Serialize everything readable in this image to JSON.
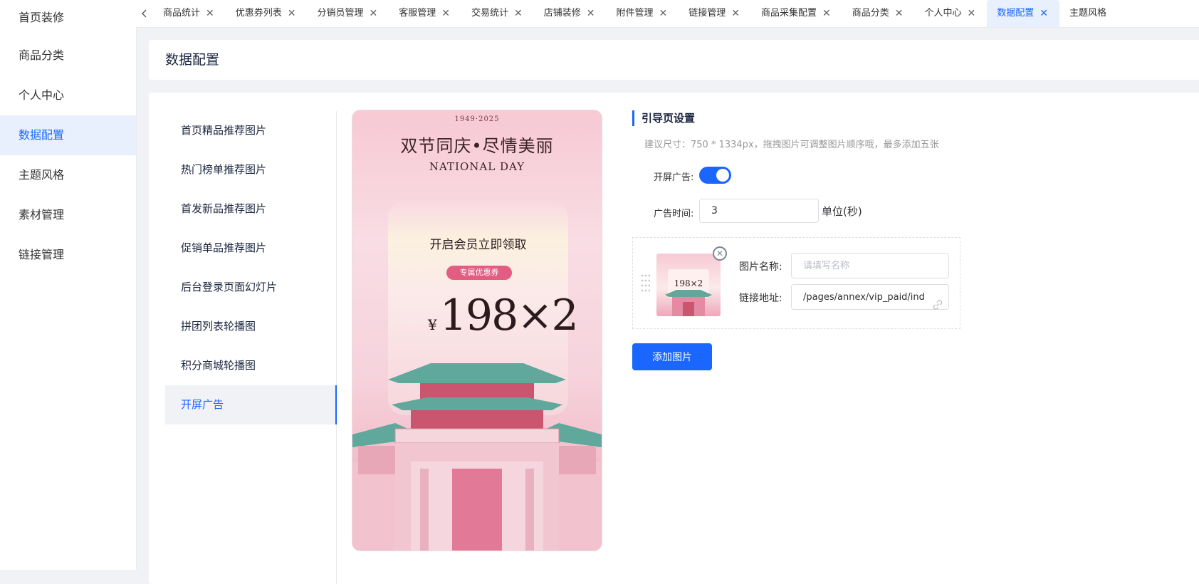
{
  "sidebar": {
    "items": [
      {
        "label": "首页装修"
      },
      {
        "label": "商品分类"
      },
      {
        "label": "个人中心"
      },
      {
        "label": "数据配置",
        "active": true
      },
      {
        "label": "主题风格"
      },
      {
        "label": "素材管理"
      },
      {
        "label": "链接管理"
      }
    ]
  },
  "tabs": [
    {
      "label": "商品统计"
    },
    {
      "label": "优惠券列表"
    },
    {
      "label": "分销员管理"
    },
    {
      "label": "客服管理"
    },
    {
      "label": "交易统计"
    },
    {
      "label": "店铺装修"
    },
    {
      "label": "附件管理"
    },
    {
      "label": "链接管理"
    },
    {
      "label": "商品采集配置"
    },
    {
      "label": "商品分类"
    },
    {
      "label": "个人中心"
    },
    {
      "label": "数据配置",
      "active": true
    },
    {
      "label": "主题风格"
    }
  ],
  "page": {
    "title": "数据配置"
  },
  "menu": {
    "items": [
      {
        "label": "首页精品推荐图片"
      },
      {
        "label": "热门榜单推荐图片"
      },
      {
        "label": "首发新品推荐图片"
      },
      {
        "label": "促销单品推荐图片"
      },
      {
        "label": "后台登录页面幻灯片"
      },
      {
        "label": "拼团列表轮播图"
      },
      {
        "label": "积分商城轮播图"
      },
      {
        "label": "开屏广告",
        "active": true
      }
    ]
  },
  "preview": {
    "year": "1949·2025",
    "title": "双节同庆•尽情美丽",
    "subtitle": "NATIONAL DAY",
    "card_title": "开启会员立即领取",
    "badge": "专属优惠券",
    "currency": "¥",
    "price": "198×2"
  },
  "settings": {
    "section_title": "引导页设置",
    "hint": "建议尺寸：750 * 1334px，拖拽图片可调整图片顺序哦，最多添加五张",
    "ad_switch_label": "开屏广告:",
    "ad_switch_on": true,
    "ad_time_label": "广告时间:",
    "ad_time_value": "3",
    "ad_time_unit": "单位(秒)",
    "image_item": {
      "thumb_price": "198×2",
      "name_label": "图片名称:",
      "name_placeholder": "请填写名称",
      "name_value": "",
      "link_label": "链接地址:",
      "link_value": "/pages/annex/vip_paid/index"
    },
    "add_button": "添加图片"
  },
  "colors": {
    "accent": "#1a66ff",
    "active_bg": "#e8f0fe",
    "page_bg": "#f0f2f5"
  }
}
